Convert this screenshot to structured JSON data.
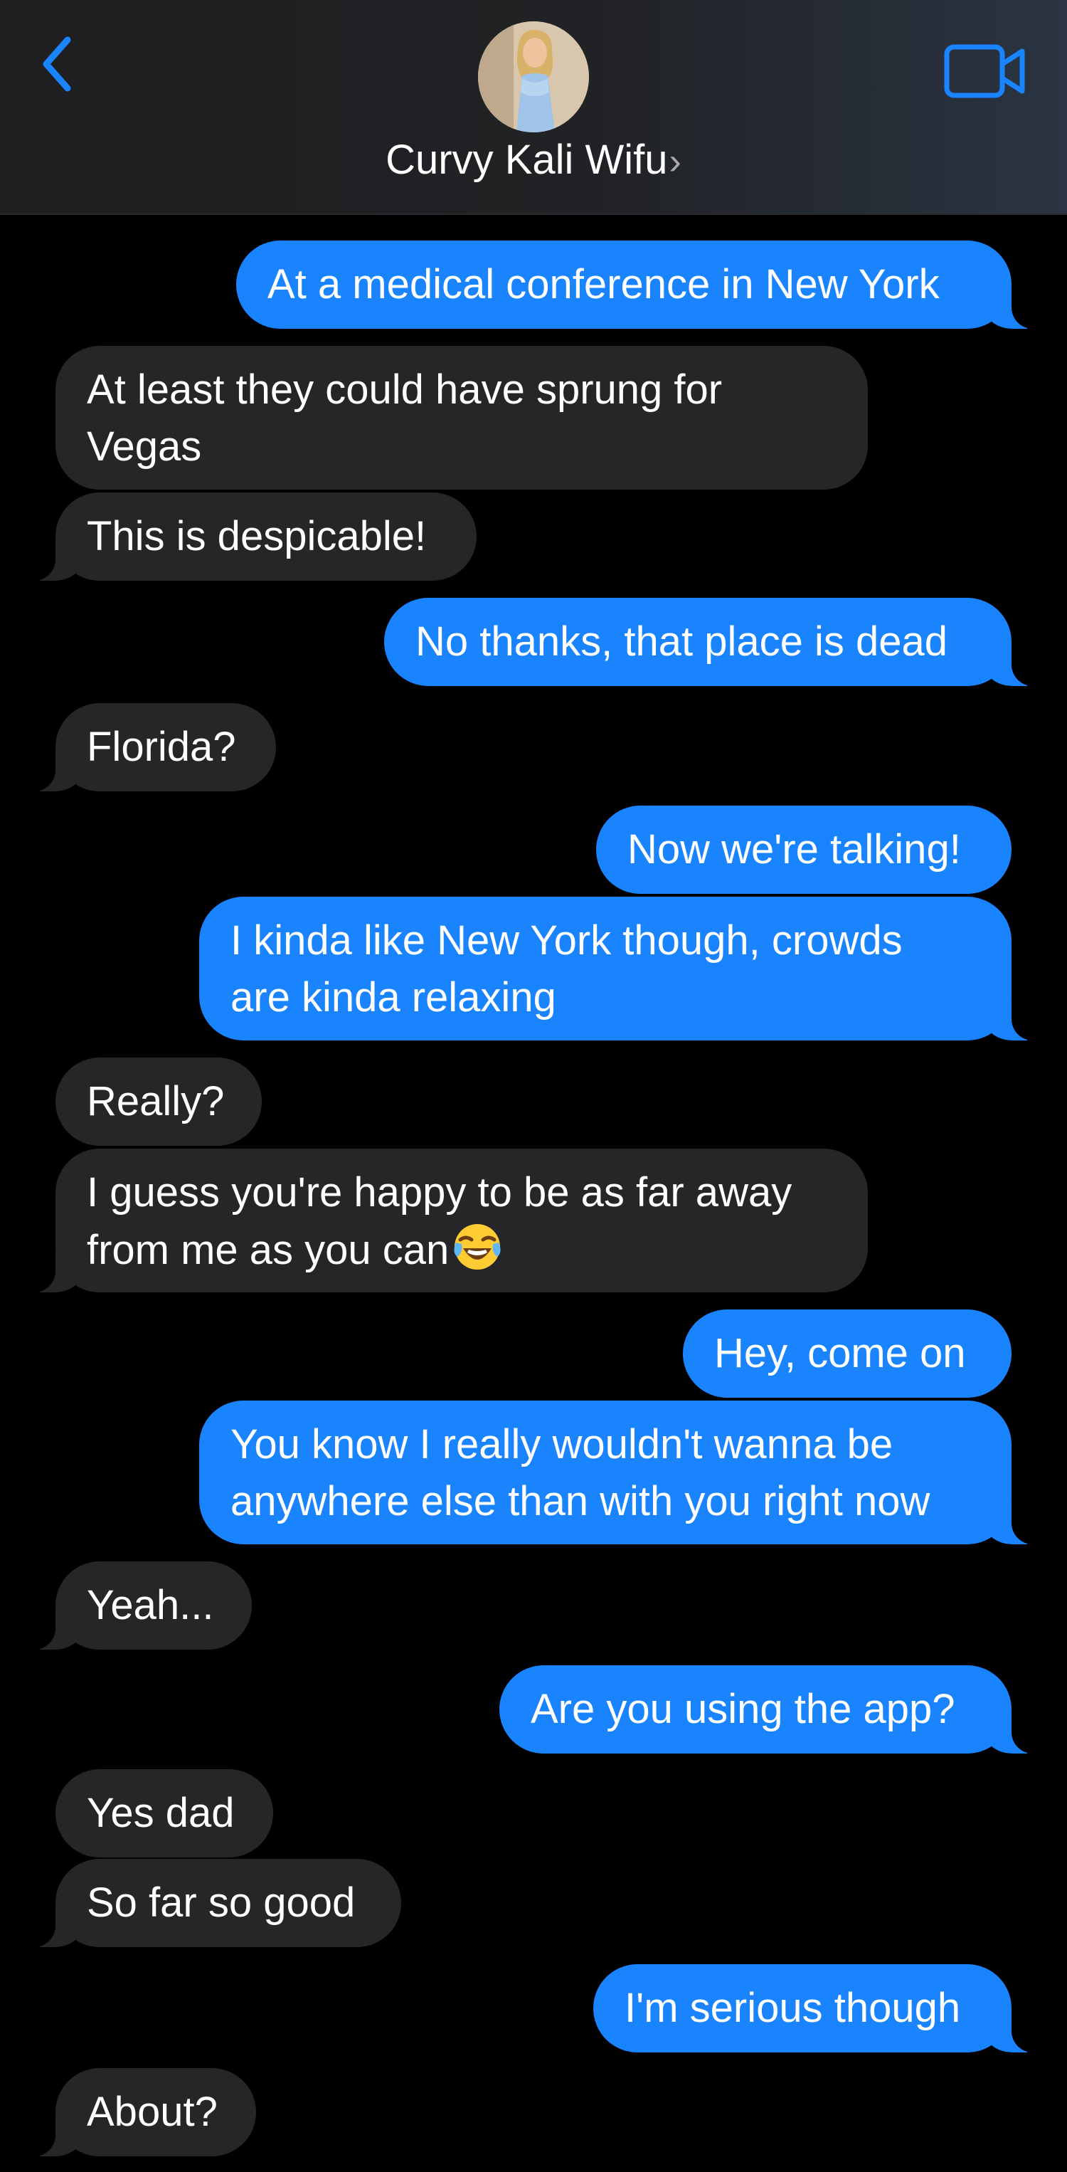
{
  "header": {
    "contact_name": "Curvy Kali Wifu",
    "chevron": "›",
    "back_icon": "chevron-left-icon",
    "video_icon": "video-camera-icon",
    "accent_color": "#1a84ff"
  },
  "messages": [
    {
      "from": "me",
      "text": "At a medical conference in New York"
    },
    {
      "from": "them",
      "text": "At least they could have sprung for\nVegas"
    },
    {
      "from": "them",
      "text": "This is despicable!"
    },
    {
      "from": "me",
      "text": "No thanks, that place is dead"
    },
    {
      "from": "them",
      "text": "Florida?"
    },
    {
      "from": "me",
      "text": "Now we're talking!"
    },
    {
      "from": "me",
      "text": "I kinda like New York though, crowds\nare kinda relaxing"
    },
    {
      "from": "them",
      "text": "Really?"
    },
    {
      "from": "them",
      "text": "I guess you're happy to be as far away\nfrom me as you can",
      "emoji": "face-with-tears-of-joy"
    },
    {
      "from": "me",
      "text": "Hey, come on"
    },
    {
      "from": "me",
      "text": "You know I really wouldn't wanna be\nanywhere else than with you right now"
    },
    {
      "from": "them",
      "text": "Yeah..."
    },
    {
      "from": "me",
      "text": "Are you using the app?"
    },
    {
      "from": "them",
      "text": "Yes dad"
    },
    {
      "from": "them",
      "text": "So far so good"
    },
    {
      "from": "me",
      "text": "I'm serious though"
    },
    {
      "from": "them",
      "text": "About?"
    }
  ]
}
